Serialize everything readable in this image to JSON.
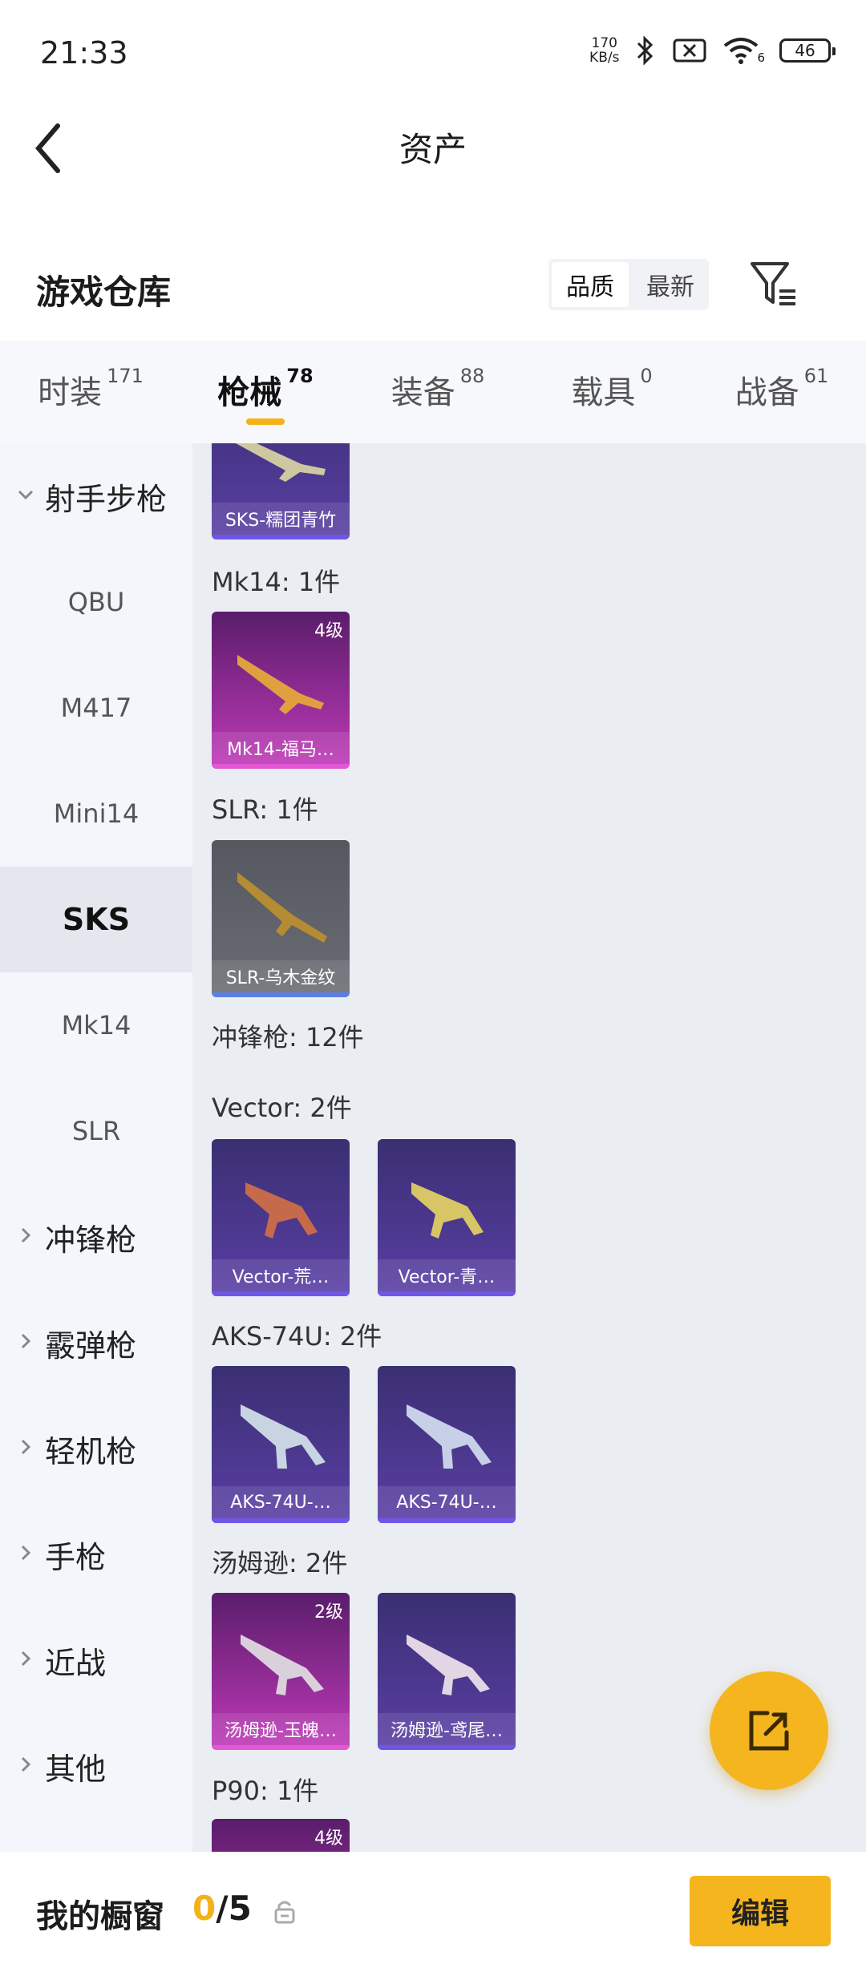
{
  "status": {
    "time": "21:33",
    "net_speed_value": "170",
    "net_speed_unit": "KB/s",
    "wifi_level": "6",
    "battery": "46"
  },
  "header": {
    "title": "资产"
  },
  "warehouse": {
    "title": "游戏仓库",
    "sort_options": [
      "品质",
      "最新"
    ],
    "selected_sort": "品质"
  },
  "tabs": [
    {
      "label": "时装",
      "count": "171"
    },
    {
      "label": "枪械",
      "count": "78",
      "active": true
    },
    {
      "label": "装备",
      "count": "88"
    },
    {
      "label": "载具",
      "count": "0"
    },
    {
      "label": "战备",
      "count": "61"
    }
  ],
  "sidebar": {
    "group_open": "射手步枪",
    "subitems": [
      "QBU",
      "M417",
      "Mini14",
      "SKS",
      "Mk14",
      "SLR"
    ],
    "selected": "SKS",
    "groups": [
      "冲锋枪",
      "霰弹枪",
      "轻机枪",
      "手枪",
      "近战",
      "其他"
    ]
  },
  "content": {
    "sections": [
      {
        "label": "Mk14: 1件"
      },
      {
        "label": "SLR: 1件"
      },
      {
        "label": "冲锋枪: 12件"
      },
      {
        "label": "Vector: 2件"
      },
      {
        "label": "AKS-74U: 2件"
      },
      {
        "label": "汤姆逊: 2件"
      },
      {
        "label": "P90: 1件"
      }
    ],
    "items": [
      {
        "name": "SKS-糯团青竹",
        "level": ""
      },
      {
        "name": "Mk14-福马…",
        "level": "4级"
      },
      {
        "name": "SLR-乌木金纹",
        "level": ""
      },
      {
        "name": "Vector-荒…",
        "level": ""
      },
      {
        "name": "Vector-青…",
        "level": ""
      },
      {
        "name": "AKS-74U-…",
        "level": ""
      },
      {
        "name": "AKS-74U-…",
        "level": ""
      },
      {
        "name": "汤姆逊-玉魄…",
        "level": "2级"
      },
      {
        "name": "汤姆逊-鸢尾…",
        "level": ""
      },
      {
        "name": "",
        "level": "4级"
      }
    ]
  },
  "showcase": {
    "label": "我的橱窗",
    "current": "0",
    "total": "/5",
    "edit_label": "编辑"
  },
  "colors": {
    "accent": "#f5b51f",
    "purple": "#5a3fa5",
    "pink": "#c039b8"
  }
}
